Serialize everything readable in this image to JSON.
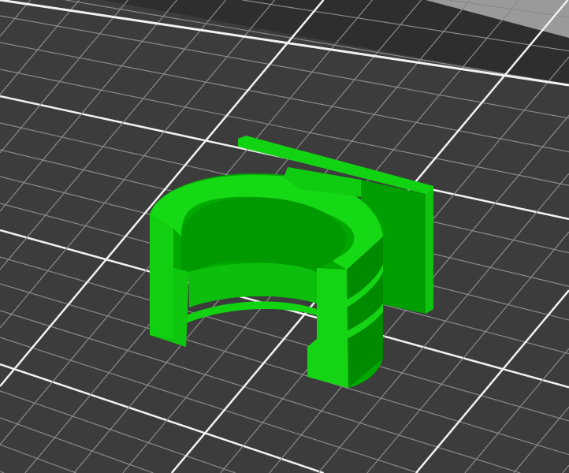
{
  "viewport": {
    "background_color": "#2e2e2e",
    "bed_color": "#3c3c3c",
    "corner_color": "#9a9a9a",
    "major_grid_color": "#f2f2f2",
    "minor_grid_color": "#8a8a8a",
    "model": {
      "icon": "3d-model-part",
      "color_light": "#11d311",
      "color_mid": "#00b300",
      "color_dark": "#008a00"
    }
  }
}
